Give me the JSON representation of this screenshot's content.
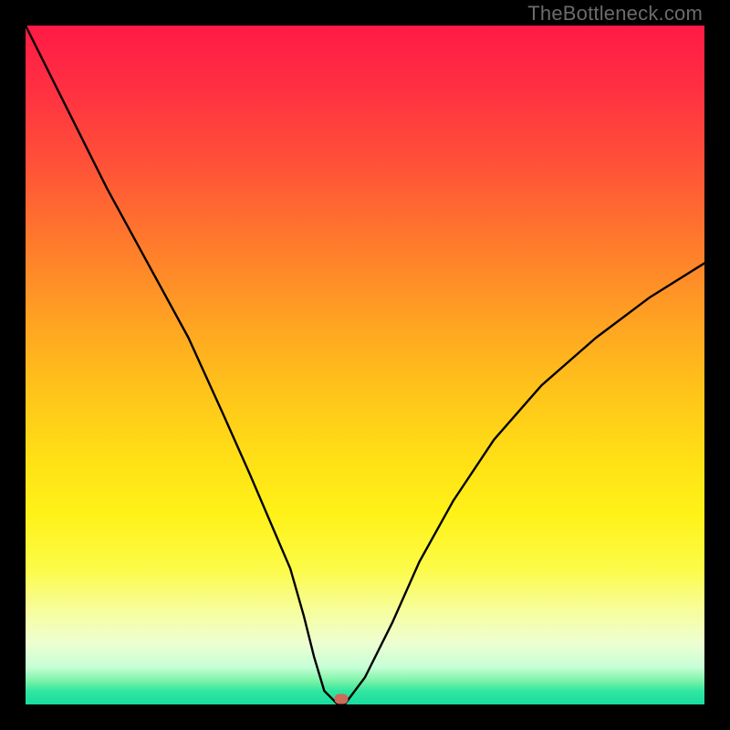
{
  "watermark": "TheBottleneck.com",
  "chart_data": {
    "type": "line",
    "title": "",
    "xlabel": "",
    "ylabel": "",
    "xlim": [
      0,
      100
    ],
    "ylim": [
      0,
      100
    ],
    "grid": false,
    "series": [
      {
        "name": "curve",
        "x": [
          0,
          6,
          12,
          18,
          24,
          29,
          33,
          36,
          39,
          41,
          42.5,
          44,
          46,
          47,
          50,
          54,
          58,
          63,
          69,
          76,
          84,
          92,
          100
        ],
        "y": [
          100,
          88,
          76,
          65,
          54,
          43,
          34,
          27,
          20,
          13,
          7,
          2,
          0,
          0,
          4,
          12,
          21,
          30,
          39,
          47,
          54,
          60,
          65
        ]
      }
    ],
    "marker": {
      "x": 46.5,
      "y": 0.8,
      "color": "#cd6a59"
    },
    "background_gradient": {
      "top": "#ff1a45",
      "mid": "#ffe016",
      "bottom": "#17dca0"
    }
  }
}
